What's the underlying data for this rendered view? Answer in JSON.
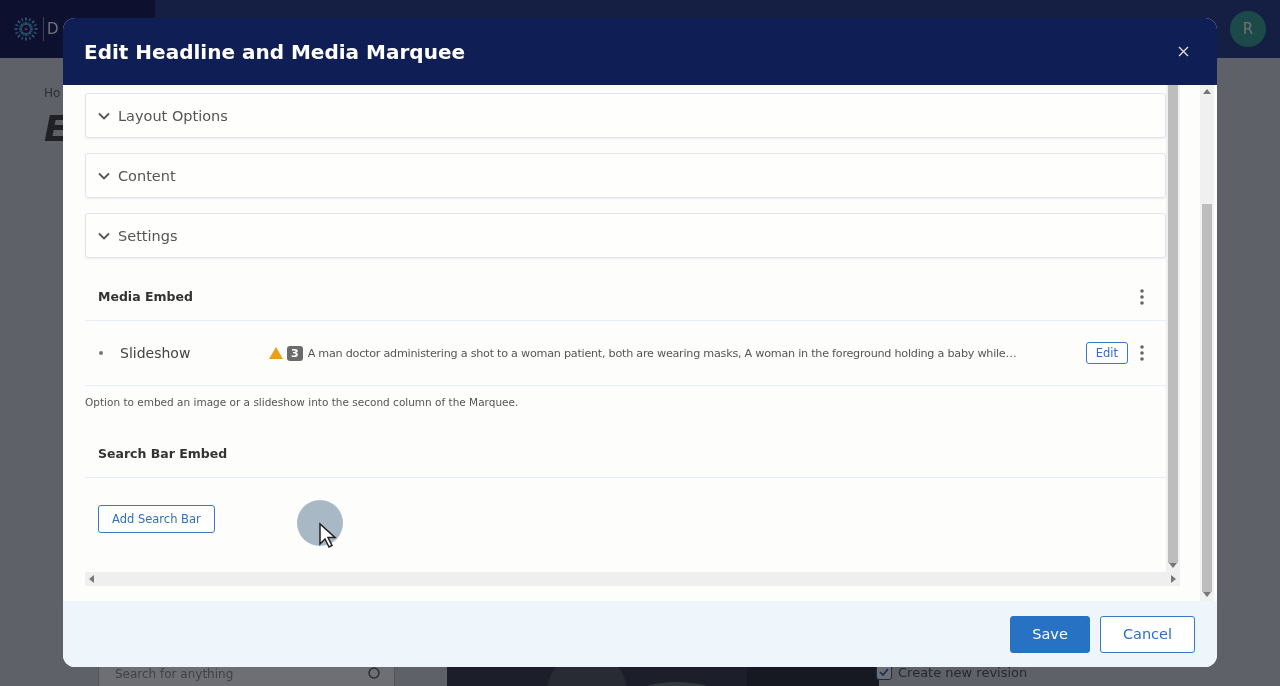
{
  "background": {
    "brand": "D",
    "avatar": "R",
    "breadcrumb": "Ho",
    "heading": "E",
    "search": {
      "placeholder": "Search for anything"
    },
    "revision": {
      "label": "Create new revision",
      "checked": true
    }
  },
  "modal": {
    "title": "Edit Headline and Media Marquee",
    "sections": [
      {
        "label": "Layout Options",
        "expanded": false
      },
      {
        "label": "Content",
        "expanded": false
      },
      {
        "label": "Settings",
        "expanded": false
      }
    ],
    "media_embed": {
      "title": "Media Embed",
      "items": [
        {
          "type": "Slideshow",
          "warning": true,
          "count": "3",
          "description": "A man doctor administering a shot to a woman patient, both are wearing masks, A woman in the foreground holding a baby while…",
          "action": "Edit"
        }
      ],
      "help": "Option to embed an image or a slideshow into the second column of the Marquee."
    },
    "search_bar_embed": {
      "title": "Search Bar Embed",
      "button": "Add Search Bar"
    },
    "buttons": [
      {
        "label": "Save",
        "kind": "primary"
      },
      {
        "label": "Cancel",
        "kind": "secondary"
      }
    ]
  }
}
